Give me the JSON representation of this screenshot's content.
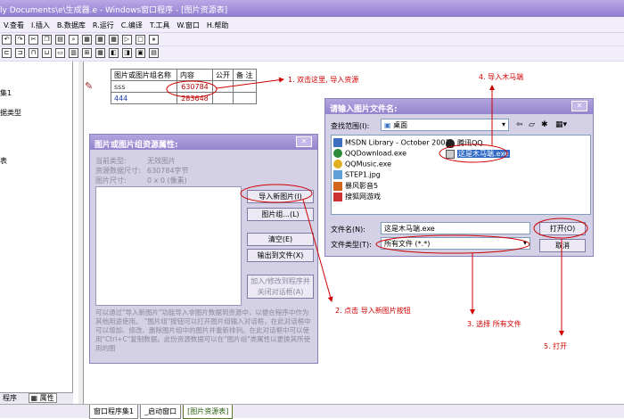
{
  "window": {
    "title": "ly Documents\\e\\生成器.e - Windows窗口程序 - [图片资源表]"
  },
  "menu": [
    "V.查看",
    "I.插入",
    "B.数据库",
    "R.运行",
    "C.编译",
    "T.工具",
    "W.窗口",
    "H.帮助"
  ],
  "left_panel": {
    "items": [
      "集1",
      "据类型",
      "表"
    ],
    "tabs": [
      "程序",
      "属性"
    ]
  },
  "status_tabs": [
    "窗口程序集1",
    "_启动窗口",
    "[图片资源表]"
  ],
  "resource_table": {
    "headers": [
      "图片或图片组名称",
      "内容",
      "公开",
      "备 注"
    ],
    "rows": [
      {
        "name": "sss",
        "content": "630784"
      },
      {
        "name": "444",
        "content": "283648"
      }
    ]
  },
  "img_dialog": {
    "title": "图片或图片组资源属性:",
    "info": [
      {
        "label": "当前类型:",
        "value": "无效图片"
      },
      {
        "label": "资源数据尺寸:",
        "value": "630784字节"
      },
      {
        "label": "图片尺寸:",
        "value": "0 x 0 (像素)"
      }
    ],
    "buttons": {
      "import": "导入新图片(I)",
      "group": "图片组...(L)",
      "clear": "清空(E)",
      "export": "输出到文件(X)",
      "add_close": "加入/修改到程序并关闭对话框(A)"
    },
    "help_text": "可以通过\"导入新图片\"功能导入非图片数据到资源中，以便在程序中作为其他用途使用。 \"图片组\"按钮可以打开图片组输入对话框，在此对话框中可以增加、修改、删除图片组中的图片并重新排列。在此对话框中可以使用\"Ctrl+C\"复制数据。此份资源数据可以在\"图片组\"类属性以更换其所使用的图"
  },
  "file_dialog": {
    "title": "请输入图片文件名:",
    "look_in_label": "查找范围(I):",
    "look_in_value": "桌面",
    "files": [
      {
        "name": "MSDN Library - October 2001",
        "icon": "doc-icon"
      },
      {
        "name": "QQDownload.exe",
        "icon": "exe-icon"
      },
      {
        "name": "QQMusic.exe",
        "icon": "exe-icon"
      },
      {
        "name": "STEP1.jpg",
        "icon": "image-icon"
      },
      {
        "name": "暴风影音5",
        "icon": "shortcut-icon"
      },
      {
        "name": "搜狐网游戏",
        "icon": "shortcut-icon"
      },
      {
        "name": "腾讯QQ",
        "icon": "qq-icon"
      },
      {
        "name": "这是木马端.exe",
        "icon": "exe-icon"
      }
    ],
    "filename_label": "文件名(N):",
    "filename_value": "这是木马端.exe",
    "filetype_label": "文件类型(T):",
    "filetype_value": "所有文件 (*.*)",
    "open_button": "打开(O)",
    "cancel_button": "取消"
  },
  "annotations": [
    "1. 双击这里, 导入资源",
    "2. 点击 导入新图片按钮",
    "3. 选择 所有文件",
    "4. 导入木马端",
    "5. 打开"
  ],
  "colors": {
    "annotation": "#d00000",
    "title_bar": "#9484cf",
    "dialog_bg": "#d4d0e6",
    "selection": "#316ac5"
  }
}
